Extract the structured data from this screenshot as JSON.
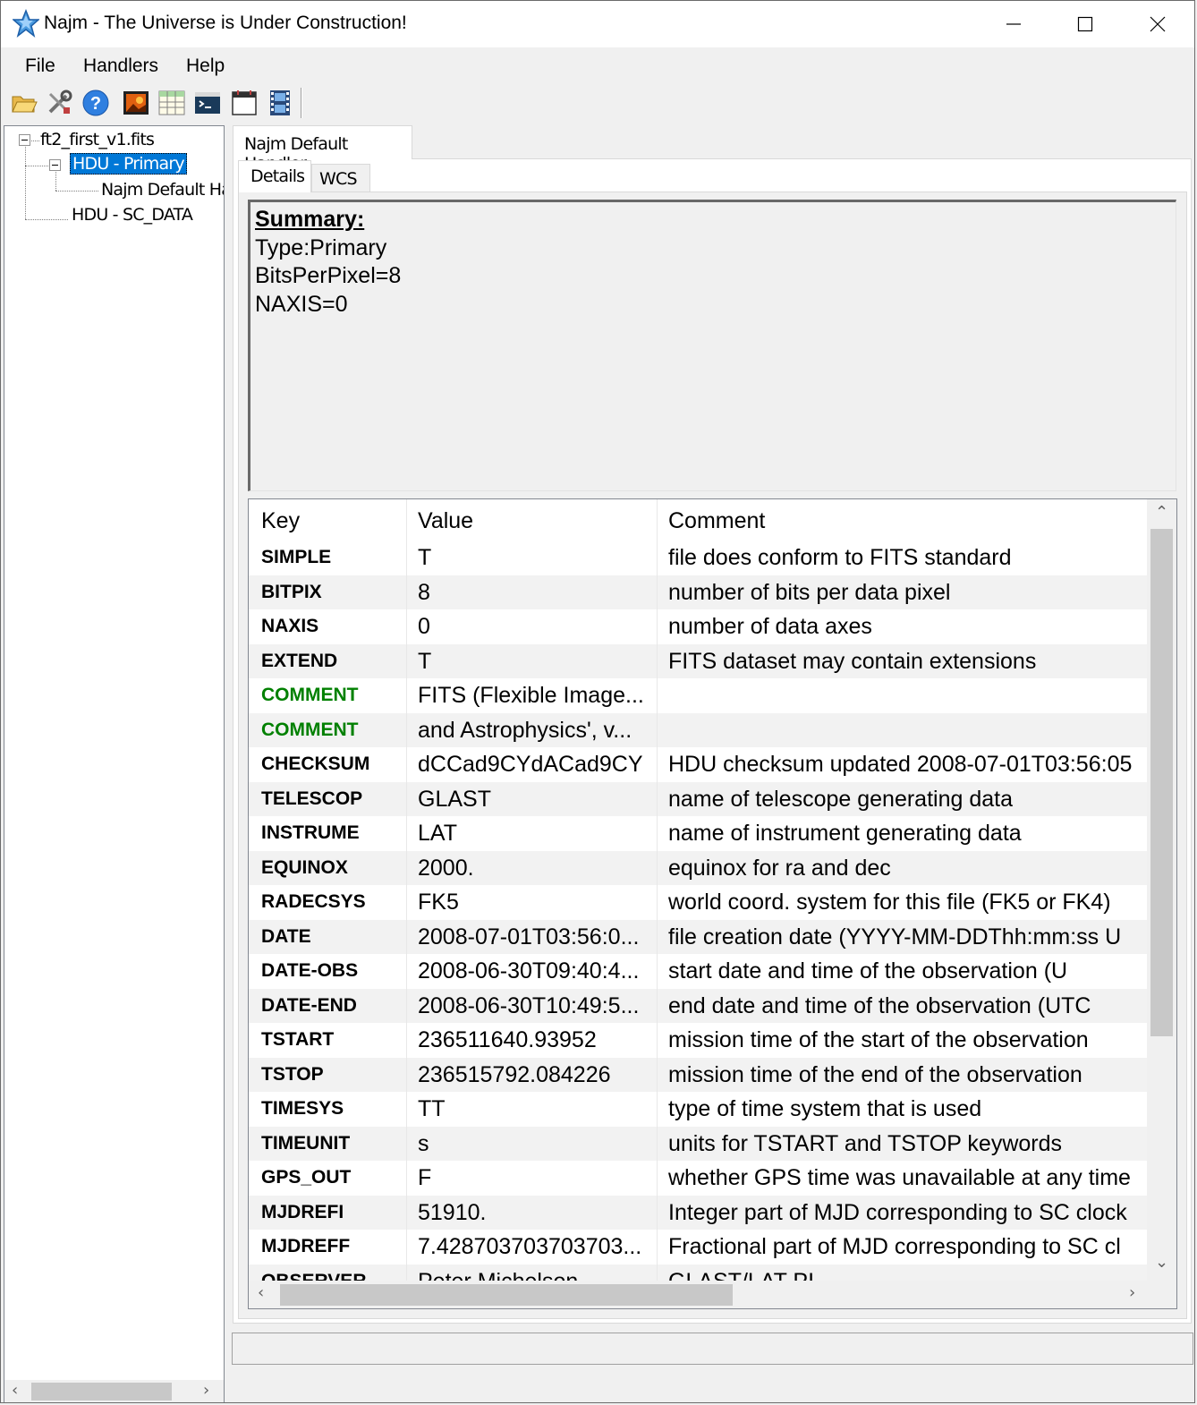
{
  "window": {
    "title": "Najm - The Universe is Under Construction!",
    "minimize_icon": "minimize-icon",
    "maximize_icon": "maximize-icon",
    "close_icon": "close-icon"
  },
  "menu": [
    {
      "label": "File"
    },
    {
      "label": "Handlers"
    },
    {
      "label": "Help"
    }
  ],
  "toolbar": [
    {
      "name": "open-folder-icon"
    },
    {
      "name": "tools-icon"
    },
    {
      "name": "help-icon"
    },
    {
      "name": "image-icon"
    },
    {
      "name": "table-icon"
    },
    {
      "name": "console-icon"
    },
    {
      "name": "calendar-icon"
    },
    {
      "name": "film-icon"
    }
  ],
  "tree": {
    "file": "ft2_first_v1.fits",
    "hdu_primary": "HDU - Primary",
    "handler": "Najm Default Ha",
    "hdu_sc": "HDU - SC_DATA"
  },
  "tabs": {
    "outer": "Najm Default Handler",
    "details": "Details",
    "wcs": "WCS"
  },
  "summary": {
    "heading": "Summary:",
    "lines": [
      "Type:Primary",
      "BitsPerPixel=8",
      "NAXIS=0"
    ]
  },
  "grid": {
    "headers": {
      "key": "Key",
      "value": "Value",
      "comment": "Comment"
    },
    "rows": [
      {
        "key": "SIMPLE",
        "value": "T",
        "comment": "file does conform to FITS standard"
      },
      {
        "key": "BITPIX",
        "value": "8",
        "comment": "number of bits per data pixel"
      },
      {
        "key": "NAXIS",
        "value": "0",
        "comment": "number of data axes"
      },
      {
        "key": "EXTEND",
        "value": "T",
        "comment": "FITS dataset may contain extensions"
      },
      {
        "key": "COMMENT",
        "value": "FITS (Flexible Image...",
        "comment": ""
      },
      {
        "key": "COMMENT",
        "value": "and Astrophysics', v...",
        "comment": ""
      },
      {
        "key": "CHECKSUM",
        "value": "dCCad9CYdACad9CY",
        "comment": "HDU checksum updated 2008-07-01T03:56:05"
      },
      {
        "key": "TELESCOP",
        "value": "GLAST",
        "comment": "name of telescope generating data"
      },
      {
        "key": "INSTRUME",
        "value": "LAT",
        "comment": "name of instrument generating data"
      },
      {
        "key": "EQUINOX",
        "value": "2000.",
        "comment": "equinox for ra and dec"
      },
      {
        "key": "RADECSYS",
        "value": "FK5",
        "comment": "world coord. system for this file (FK5 or FK4)"
      },
      {
        "key": "DATE",
        "value": "2008-07-01T03:56:0...",
        "comment": "file creation date (YYYY-MM-DDThh:mm:ss U"
      },
      {
        "key": "DATE-OBS",
        "value": "2008-06-30T09:40:4...",
        "comment": "start date and time of the observation (U"
      },
      {
        "key": "DATE-END",
        "value": "2008-06-30T10:49:5...",
        "comment": "end date and time of the observation (UTC"
      },
      {
        "key": "TSTART",
        "value": "236511640.93952",
        "comment": "mission time of the start of the observation"
      },
      {
        "key": "TSTOP",
        "value": "236515792.084226",
        "comment": "mission time of the end of the observation"
      },
      {
        "key": "TIMESYS",
        "value": "TT",
        "comment": "type of time system that is used"
      },
      {
        "key": "TIMEUNIT",
        "value": "s",
        "comment": "units for TSTART and TSTOP keywords"
      },
      {
        "key": "GPS_OUT",
        "value": "F",
        "comment": "whether GPS time was unavailable at any time"
      },
      {
        "key": "MJDREFI",
        "value": "51910.",
        "comment": "Integer part of MJD corresponding to SC clock"
      },
      {
        "key": "MJDREFF",
        "value": "7.428703703703703...",
        "comment": "Fractional part of MJD corresponding to SC cl"
      },
      {
        "key": "OBSERVER",
        "value": "Peter Michelson",
        "comment": "GLAST/LAT PI"
      }
    ]
  },
  "colors": {
    "selection": "#0078d7",
    "comment_key": "#008000"
  }
}
